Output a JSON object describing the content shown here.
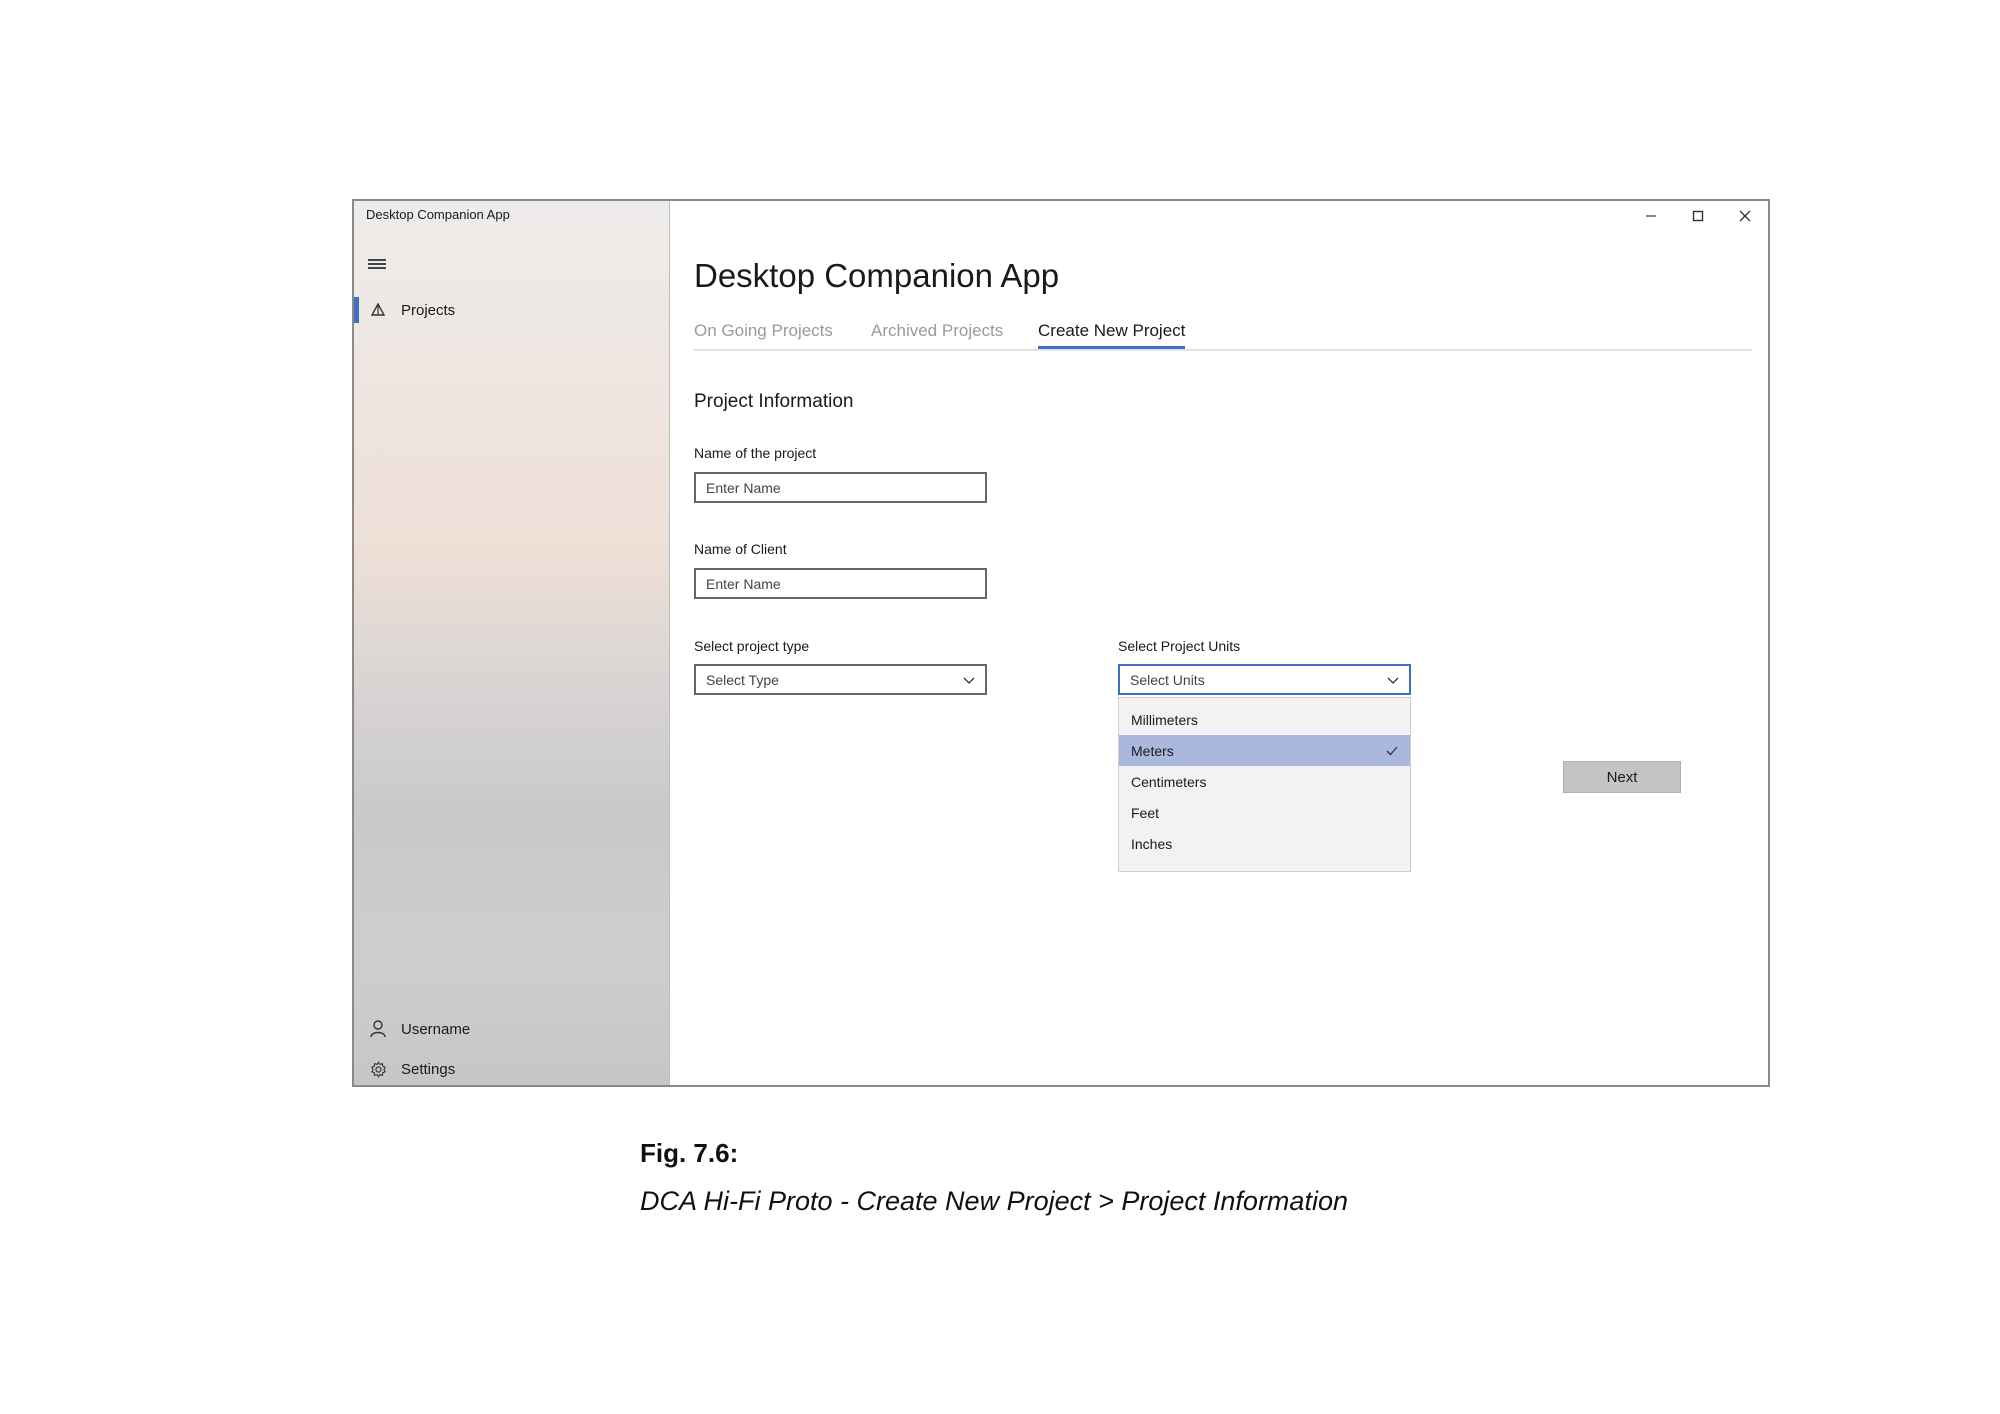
{
  "window": {
    "title": "Desktop Companion App"
  },
  "sidebar": {
    "items": [
      {
        "label": "Projects",
        "icon": "projects-icon",
        "active": true
      }
    ],
    "footer": [
      {
        "label": "Username",
        "icon": "user-icon"
      },
      {
        "label": "Settings",
        "icon": "gear-icon"
      }
    ]
  },
  "main": {
    "title": "Desktop Companion App",
    "tabs": [
      {
        "label": "On Going Projects",
        "active": false
      },
      {
        "label": "Archived Projects",
        "active": false
      },
      {
        "label": "Create New Project",
        "active": true
      }
    ],
    "section_title": "Project Information",
    "project_name": {
      "label": "Name of the project",
      "placeholder": "Enter Name",
      "value": ""
    },
    "client_name": {
      "label": "Name of Client",
      "placeholder": "Enter Name",
      "value": ""
    },
    "project_type": {
      "label": "Select project type",
      "value": "Select Type"
    },
    "project_units": {
      "label": "Select Project Units",
      "value": "Select Units",
      "options": [
        "Millimeters",
        "Meters",
        "Centimeters",
        "Feet",
        "Inches"
      ],
      "selected_index": 1
    },
    "next_button": "Next"
  },
  "caption": {
    "number": "Fig. 7.6:",
    "text": "DCA Hi-Fi Proto - Create New Project > Project Information"
  },
  "colors": {
    "accent": "#3f6fc4",
    "selected_option": "#a9b8dc",
    "button": "#c4c4c4"
  }
}
